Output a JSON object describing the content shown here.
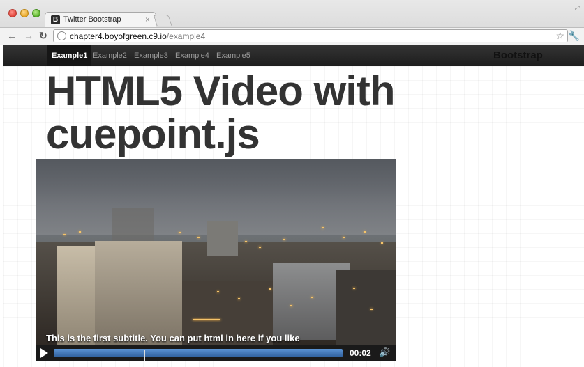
{
  "browser": {
    "tab_title": "Twitter Bootstrap",
    "tab_favicon": "B",
    "tab_close": "×",
    "url_host": "chapter4.boyofgreen.c9.io",
    "url_path": "/example4"
  },
  "navbar": {
    "items": [
      {
        "label": "Example1",
        "active": true
      },
      {
        "label": "Example2",
        "active": false
      },
      {
        "label": "Example3",
        "active": false
      },
      {
        "label": "Example4",
        "active": false
      },
      {
        "label": "Example5",
        "active": false
      }
    ],
    "brand": "Bootstrap"
  },
  "main": {
    "headline_line1": "HTML5 Video with",
    "headline_line2": "cuepoint.js"
  },
  "video": {
    "subtitle": "This is the first subtitle. You can put html in here if you like",
    "time": "00:02"
  },
  "icons": {
    "back": "back-arrow-icon",
    "forward": "forward-arrow-icon",
    "reload": "reload-icon",
    "page": "page-icon",
    "star": "star-icon",
    "wrench": "wrench-icon",
    "play": "play-icon",
    "volume": "volume-icon"
  },
  "colors": {
    "navbar_bg": "#222222",
    "progress": "#3a6eb0",
    "headline": "#333333"
  }
}
